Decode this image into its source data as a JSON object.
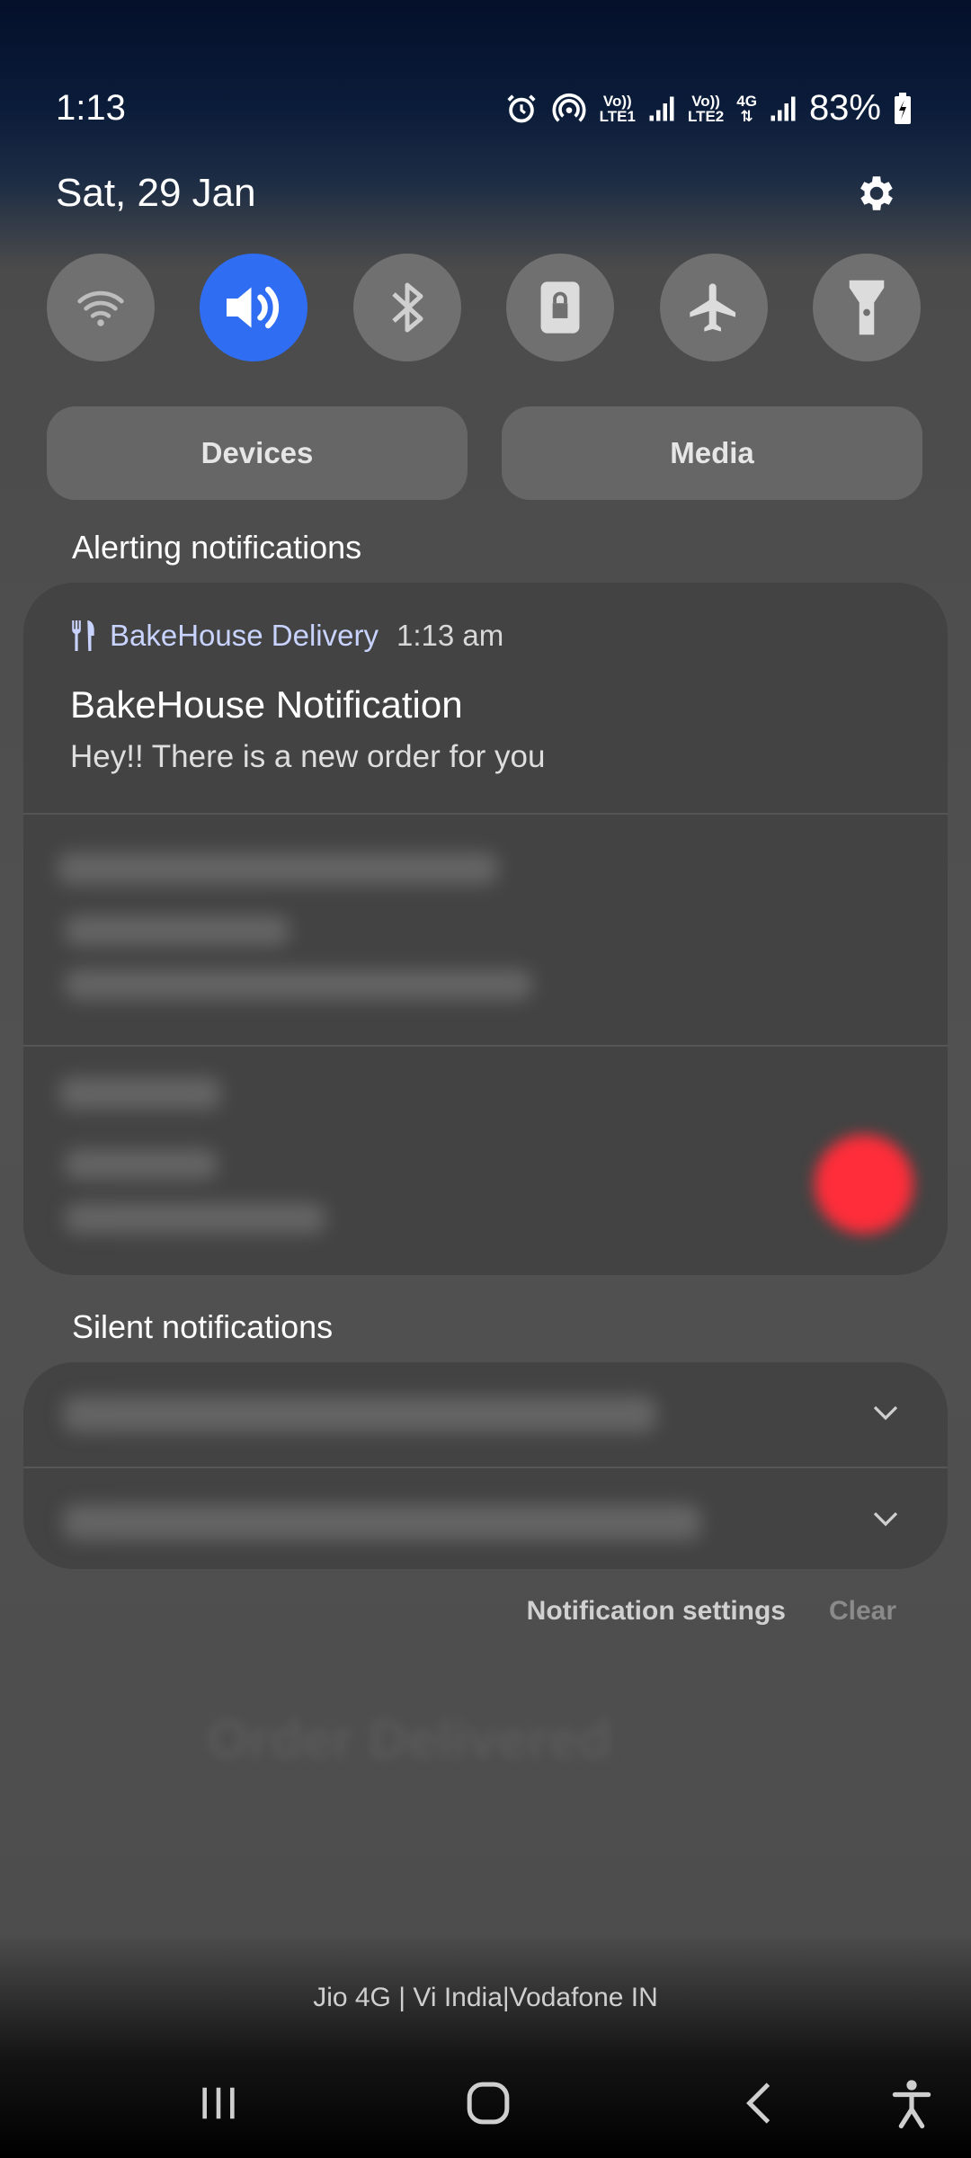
{
  "status_bar": {
    "time": "1:13",
    "sim1_label_top": "Vo))",
    "sim1_label_bottom": "LTE1",
    "sim2_label_top": "Vo))",
    "sim2_label_bottom": "LTE2",
    "network": "4G",
    "battery": "83%"
  },
  "header": {
    "date": "Sat, 29 Jan"
  },
  "quick_toggles": [
    {
      "name": "wifi",
      "icon": "wifi-icon",
      "active": false
    },
    {
      "name": "sound",
      "icon": "sound-icon",
      "active": true
    },
    {
      "name": "bluetooth",
      "icon": "bluetooth-icon",
      "active": false
    },
    {
      "name": "rotation-lock",
      "icon": "lock-icon",
      "active": false
    },
    {
      "name": "airplane",
      "icon": "airplane-icon",
      "active": false
    },
    {
      "name": "flashlight",
      "icon": "flashlight-icon",
      "active": false
    }
  ],
  "buttons": {
    "devices": "Devices",
    "media": "Media"
  },
  "sections": {
    "alerting": "Alerting notifications",
    "silent": "Silent notifications"
  },
  "notification": {
    "app_name": "BakeHouse Delivery",
    "time": "1:13 am",
    "title": "BakeHouse Notification",
    "body": "Hey!! There is a new order for you"
  },
  "footer": {
    "notification_settings": "Notification settings",
    "clear": "Clear"
  },
  "carrier": "Jio 4G | Vi India|Vodafone IN",
  "colors": {
    "accent": "#2f6df2",
    "card": "#434343",
    "toggle": "#707070"
  }
}
